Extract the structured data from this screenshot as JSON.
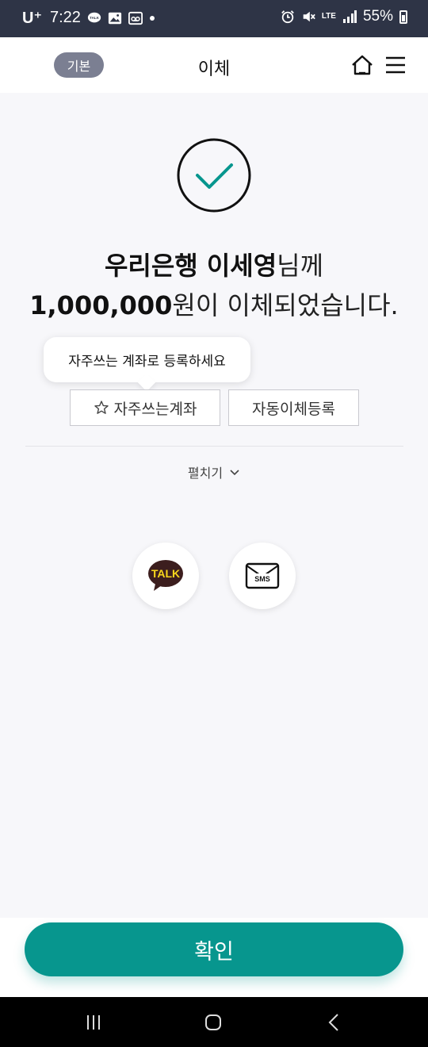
{
  "status_bar": {
    "carrier": "U⁺",
    "time": "7:22",
    "network": "LTE",
    "battery": "55%"
  },
  "header": {
    "badge": "기본",
    "title": "이체",
    "icons": [
      "home-icon",
      "menu-icon"
    ]
  },
  "result": {
    "line1_bold": "우리은행 이세영",
    "line1_rest": "님께",
    "line2_bold": "1,000,000",
    "line2_rest": "원이 이체되었습니다."
  },
  "tooltip": {
    "text": "자주쓰는 계좌로 등록하세요"
  },
  "buttons": {
    "favorite_label": "자주쓰는계좌",
    "auto_transfer_label": "자동이체등록"
  },
  "expand": {
    "label": "펼치기"
  },
  "share": {
    "kakao_label": "TALK",
    "sms_label": "SMS"
  },
  "confirm": {
    "label": "확인"
  },
  "colors": {
    "accent": "#07968e",
    "status_bar": "#2e3446",
    "badge": "#7b7f92"
  }
}
